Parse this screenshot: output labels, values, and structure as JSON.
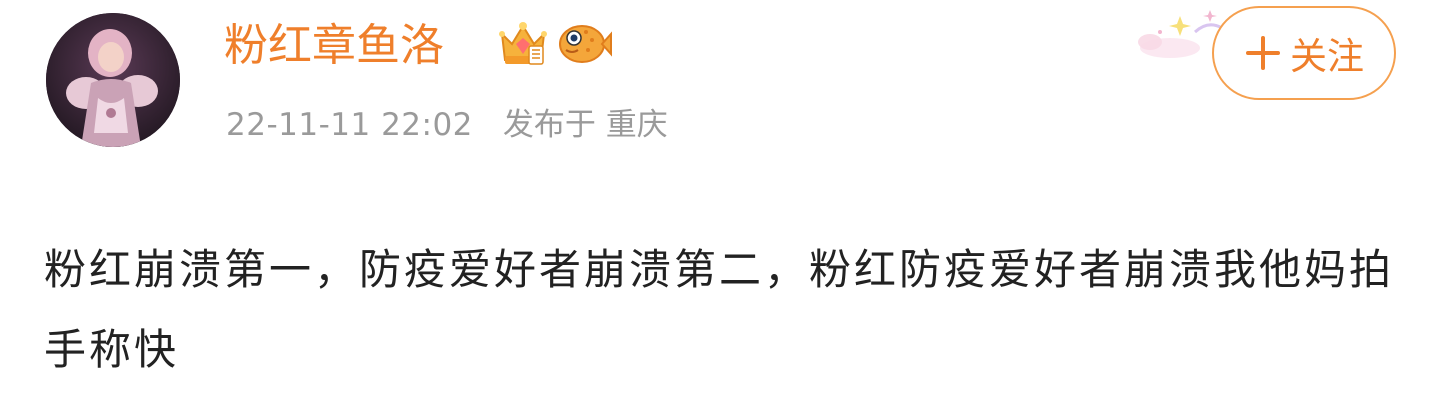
{
  "user": {
    "name": "粉红章鱼洛",
    "badges": [
      "crown-vip-icon",
      "pufferfish-icon"
    ]
  },
  "meta": {
    "date": "22-11-11 22:02",
    "published_in_label": "发布于 重庆"
  },
  "follow_button": {
    "icon": "plus-icon",
    "label": "关注"
  },
  "post": {
    "text": "粉红崩溃第一，防疫爱好者崩溃第二，粉红防疫爱好者崩溃我他妈拍手称快"
  },
  "colors": {
    "accent": "#ef7f2b",
    "follow_border": "#f5a04f",
    "meta_text": "#9a9a9a",
    "body_text": "#222222"
  }
}
